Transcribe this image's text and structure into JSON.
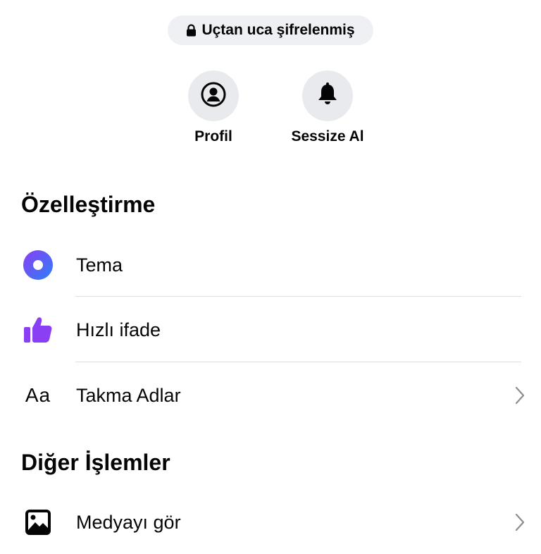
{
  "encryption": {
    "label": "Uçtan uca şifrelenmiş",
    "icon": "lock-icon"
  },
  "actions": [
    {
      "label": "Profil",
      "icon": "profile-icon"
    },
    {
      "label": "Sessize Al",
      "icon": "bell-icon"
    }
  ],
  "sections": {
    "customization": {
      "title": "Özelleştirme",
      "items": [
        {
          "label": "Tema",
          "icon": "theme-icon",
          "icon_colors": [
            "#7a3ff2",
            "#2d88ff"
          ]
        },
        {
          "label": "Hızlı ifade",
          "icon": "thumbs-up-icon",
          "icon_color": "#8b3ff5"
        },
        {
          "label": "Takma Adlar",
          "icon": "text-aa-icon",
          "icon_text": "Aa",
          "has_chevron": true
        }
      ]
    },
    "other": {
      "title": "Diğer İşlemler",
      "items": [
        {
          "label": "Medyayı gör",
          "icon": "image-icon",
          "has_chevron": true
        }
      ]
    }
  },
  "colors": {
    "pill_background": "#eff0f3",
    "action_circle": "#e9eaee",
    "divider": "#dadde1",
    "chevron": "#8a8d91"
  }
}
